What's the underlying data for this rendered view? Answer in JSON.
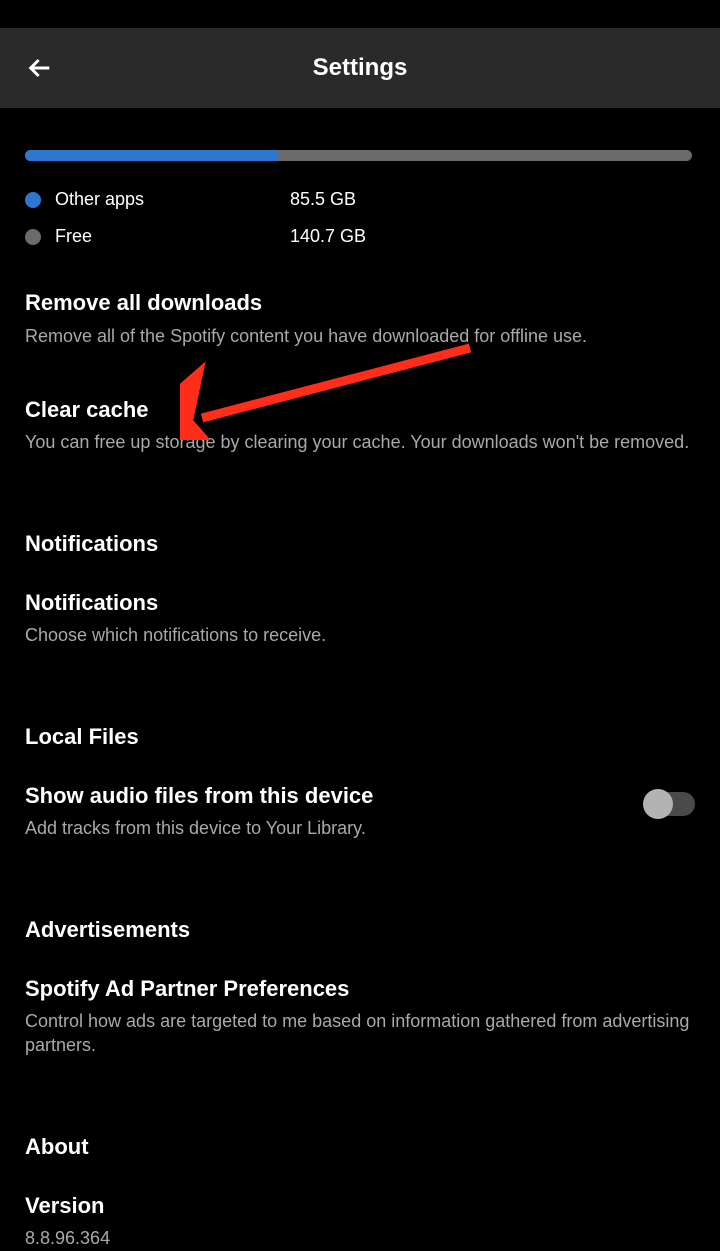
{
  "header": {
    "title": "Settings"
  },
  "storage": {
    "progress_percent": 38,
    "legend": [
      {
        "label": "Other apps",
        "value": "85.5 GB",
        "color": "#2e77d0"
      },
      {
        "label": "Free",
        "value": "140.7 GB",
        "color": "#6b6b6b"
      }
    ]
  },
  "items": {
    "remove_downloads": {
      "title": "Remove all downloads",
      "desc": "Remove all of the Spotify content you have downloaded for offline use."
    },
    "clear_cache": {
      "title": "Clear cache",
      "desc": "You can free up storage by clearing your cache. Your downloads won't be removed."
    }
  },
  "sections": {
    "notifications": {
      "header": "Notifications",
      "item": {
        "title": "Notifications",
        "desc": "Choose which notifications to receive."
      }
    },
    "local_files": {
      "header": "Local Files",
      "item": {
        "title": "Show audio files from this device",
        "desc": "Add tracks from this device to Your Library."
      }
    },
    "advertisements": {
      "header": "Advertisements",
      "item": {
        "title": "Spotify Ad Partner Preferences",
        "desc": "Control how ads are targeted to me based on information gathered from advertising partners."
      }
    },
    "about": {
      "header": "About",
      "item": {
        "title": "Version",
        "desc": "8.8.96.364"
      }
    }
  }
}
